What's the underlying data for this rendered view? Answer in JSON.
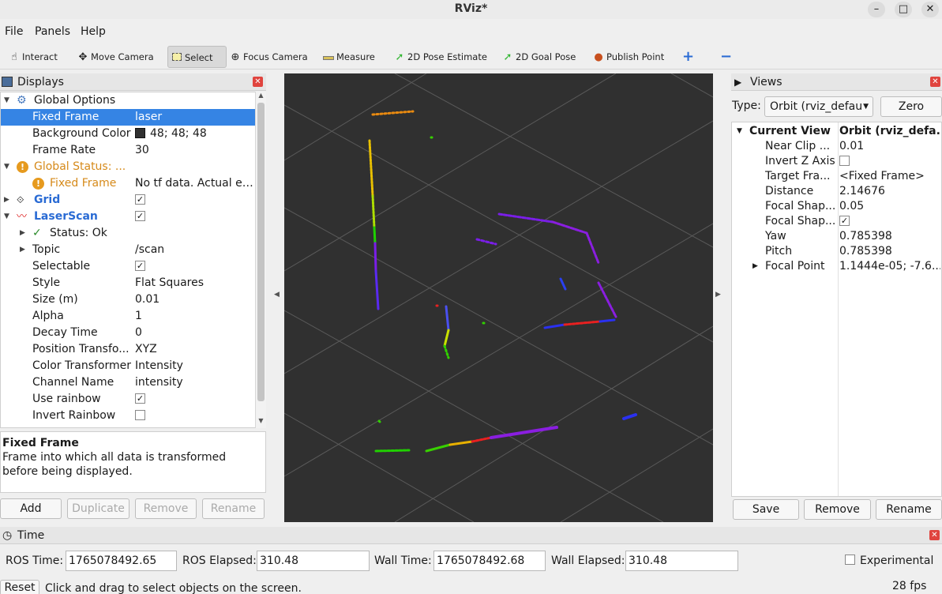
{
  "window": {
    "title": "RViz*",
    "minimize": "–",
    "maximize": "□",
    "close": "✕"
  },
  "menu": {
    "file": "File",
    "panels": "Panels",
    "help": "Help"
  },
  "toolbar": {
    "interact": "Interact",
    "move_camera": "Move Camera",
    "select": "Select",
    "focus_camera": "Focus Camera",
    "measure": "Measure",
    "pose_estimate": "2D Pose Estimate",
    "goal_pose": "2D Goal Pose",
    "publish_point": "Publish Point",
    "add": "+",
    "remove": "−"
  },
  "displays": {
    "title": "Displays",
    "rows": {
      "global_options": "Global Options",
      "fixed_frame": "Fixed Frame",
      "fixed_frame_val": "laser",
      "bg_color": "Background Color",
      "bg_color_val": "48; 48; 48",
      "frame_rate": "Frame Rate",
      "frame_rate_val": "30",
      "global_status": "Global Status: ...",
      "gs_fixed_frame": "Fixed Frame",
      "gs_fixed_frame_val": "No tf data.  Actual error: ...",
      "grid": "Grid",
      "laserscan": "LaserScan",
      "status_ok": "Status: Ok",
      "topic": "Topic",
      "topic_val": "/scan",
      "selectable": "Selectable",
      "style": "Style",
      "style_val": "Flat Squares",
      "size": "Size (m)",
      "size_val": "0.01",
      "alpha": "Alpha",
      "alpha_val": "1",
      "decay": "Decay Time",
      "decay_val": "0",
      "pos_transformer": "Position Transfo...",
      "pos_transformer_val": "XYZ",
      "color_transformer": "Color Transformer",
      "color_transformer_val": "Intensity",
      "channel": "Channel Name",
      "channel_val": "intensity",
      "use_rainbow": "Use rainbow",
      "invert_rainbow": "Invert Rainbow"
    },
    "desc_title": "Fixed Frame",
    "desc_text": "Frame into which all data is transformed before being displayed.",
    "buttons": {
      "add": "Add",
      "duplicate": "Duplicate",
      "remove": "Remove",
      "rename": "Rename"
    }
  },
  "views": {
    "title": "Views",
    "type_label": "Type:",
    "type_value": "Orbit (rviz_defau",
    "zero": "Zero",
    "current_view": "Current View",
    "current_view_val": "Orbit (rviz_defa...",
    "props": [
      {
        "name": "Near Clip ...",
        "value": "0.01"
      },
      {
        "name": "Invert Z Axis",
        "value": ""
      },
      {
        "name": "Target Fra...",
        "value": "<Fixed Frame>"
      },
      {
        "name": "Distance",
        "value": "2.14676"
      },
      {
        "name": "Focal Shap...",
        "value": "0.05"
      },
      {
        "name": "Focal Shap...",
        "value": ""
      },
      {
        "name": "Yaw",
        "value": "0.785398"
      },
      {
        "name": "Pitch",
        "value": "0.785398"
      },
      {
        "name": "Focal Point",
        "value": "1.1444e-05; -7.6..."
      }
    ],
    "buttons": {
      "save": "Save",
      "remove": "Remove",
      "rename": "Rename"
    }
  },
  "time": {
    "title": "Time",
    "ros_time_label": "ROS Time:",
    "ros_time": "1765078492.65",
    "ros_elapsed_label": "ROS Elapsed:",
    "ros_elapsed": "310.48",
    "wall_time_label": "Wall Time:",
    "wall_time": "1765078492.68",
    "wall_elapsed_label": "Wall Elapsed:",
    "wall_elapsed": "310.48",
    "experimental": "Experimental"
  },
  "status": {
    "reset": "Reset",
    "message": "Click and drag to select objects on the screen.",
    "fps": "28 fps"
  },
  "colors": {
    "background": "#303030",
    "selection": "#3584e4",
    "accent_blue": "#2a6bd4",
    "warning": "#d68a1a"
  }
}
